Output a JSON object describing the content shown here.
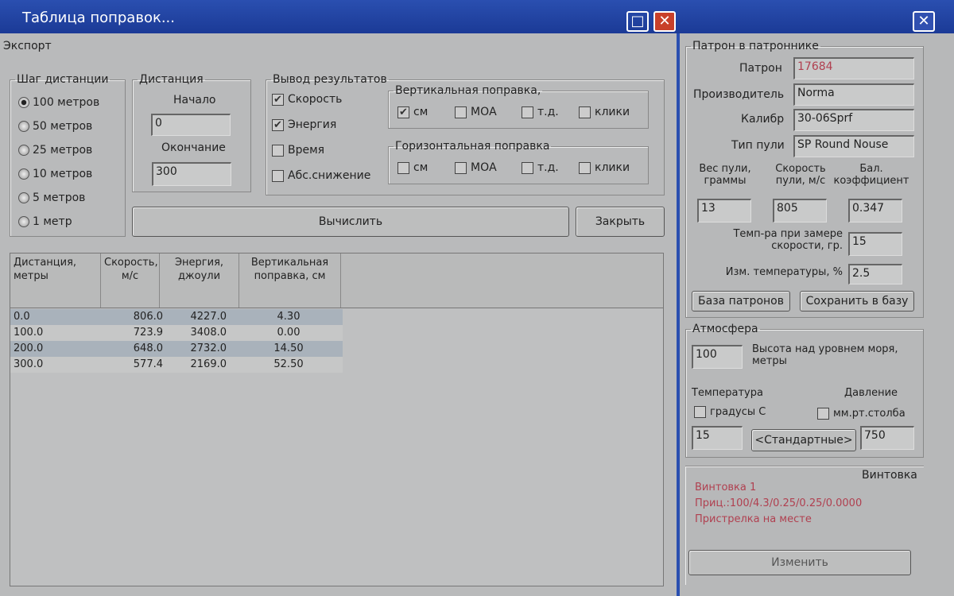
{
  "window": {
    "title": "Таблица поправок...",
    "maximize": "□",
    "close": "✕",
    "panel_close": "✕"
  },
  "menu": {
    "export": "Экспорт"
  },
  "step": {
    "legend": "Шаг дистанции",
    "options": [
      "100 метров",
      "50 метров",
      "25 метров",
      "10 метров",
      "5 метров",
      "1 метр"
    ],
    "selected": 0
  },
  "distance": {
    "legend": "Дистанция",
    "start_label": "Начало",
    "start": "0",
    "end_label": "Окончание",
    "end": "300"
  },
  "output": {
    "legend": "Вывод результатов",
    "items": [
      {
        "label": "Скорость",
        "checked": true
      },
      {
        "label": "Энергия",
        "checked": true
      },
      {
        "label": "Время",
        "checked": false
      },
      {
        "label": "Абс.снижение",
        "checked": false
      }
    ],
    "vertical": {
      "legend": "Вертикальная поправка,",
      "items": [
        {
          "label": "см",
          "checked": true
        },
        {
          "label": "МОА",
          "checked": false
        },
        {
          "label": "т.д.",
          "checked": false
        },
        {
          "label": "клики",
          "checked": false
        }
      ]
    },
    "horizontal": {
      "legend": "Горизонтальная поправка",
      "items": [
        {
          "label": "см",
          "checked": false
        },
        {
          "label": "МОА",
          "checked": false
        },
        {
          "label": "т.д.",
          "checked": false
        },
        {
          "label": "клики",
          "checked": false
        }
      ]
    }
  },
  "buttons": {
    "calculate": "Вычислить",
    "close": "Закрыть"
  },
  "table": {
    "headers": [
      "Дистанция, метры",
      "Скорость, м/с",
      "Энергия, джоули",
      "Вертикальная поправка, см"
    ],
    "rows": [
      [
        "0.0",
        "806.0",
        "4227.0",
        "4.30"
      ],
      [
        "100.0",
        "723.9",
        "3408.0",
        "0.00"
      ],
      [
        "200.0",
        "648.0",
        "2732.0",
        "14.50"
      ],
      [
        "300.0",
        "577.4",
        "2169.0",
        "52.50"
      ]
    ]
  },
  "cartridge": {
    "legend": "Патрон в патроннике",
    "patron_label": "Патрон",
    "patron": "17684",
    "maker_label": "Производитель",
    "maker": "Norma",
    "caliber_label": "Калибр",
    "caliber": "30-06Sprf",
    "bullet_label": "Тип пули",
    "bullet": "SP Round Nouse",
    "weight_label": "Вес пули, граммы",
    "weight": "13",
    "speed_label": "Скорость пули, м/с",
    "speed": "805",
    "bc_label": "Бал. коэффициент",
    "bc": "0.347",
    "temp_label": "Темп-ра при замере скорости, гр.",
    "temp": "15",
    "tchange_label": "Изм. температуры, %",
    "tchange": "2.5",
    "db_button": "База патронов",
    "save_button": "Сохранить в базу"
  },
  "atmosphere": {
    "legend": "Атмосфера",
    "altitude": "100",
    "altitude_label": "Высота над уровнем моря, метры",
    "temp_label": "Температура",
    "temp_unit": "градусы С",
    "pressure_label": "Давление",
    "pressure_unit": "мм.рт.столба",
    "temp": "15",
    "standard_button": "<Стандартные>",
    "pressure": "750"
  },
  "rifle": {
    "legend": "Винтовка",
    "name": "Винтовка 1",
    "scope": "Приц.:100/4.3/0.25/0.25/0.0000",
    "zero": "Пристрелка на месте",
    "change_button": "Изменить"
  }
}
